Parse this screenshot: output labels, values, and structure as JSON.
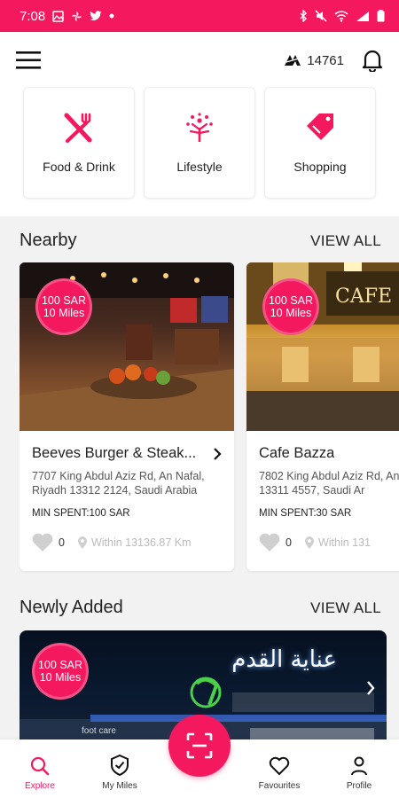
{
  "colors": {
    "accent": "#f4195f",
    "background": "#f2f2f2"
  },
  "status_bar": {
    "time": "7:08",
    "icons_left": [
      "gallery-icon",
      "pinwheel-icon",
      "twitter-icon",
      "dot-icon"
    ],
    "icons_right": [
      "bluetooth-icon",
      "mute-icon",
      "wifi-icon",
      "signal-icon",
      "battery-icon"
    ]
  },
  "header": {
    "menu_icon": "menu-icon",
    "miles_icon": "miles-icon",
    "miles_value": "14761",
    "notification_icon": "bell-icon"
  },
  "categories": [
    {
      "label": "Food & Drink",
      "icon": "fork-knife-icon"
    },
    {
      "label": "Lifestyle",
      "icon": "lifestyle-icon"
    },
    {
      "label": "Shopping",
      "icon": "shopping-tag-icon"
    }
  ],
  "nearby": {
    "title": "Nearby",
    "view_all": "VIEW ALL",
    "items": [
      {
        "badge_top": "100 SAR",
        "badge_bottom": "10 Miles",
        "name": "Beeves Burger & Steak...",
        "address": "7707 King Abdul Aziz Rd, An Nafal, Riyadh 13312 2124, Saudi Arabia",
        "min_spent": "MIN SPENT:100 SAR",
        "likes": "0",
        "distance": "Within 13136.87 Km"
      },
      {
        "badge_top": "100 SAR",
        "badge_bottom": "10 Miles",
        "name": "Cafe Bazza",
        "address": "7802 King Abdul Aziz Rd, An Riyadh 13311 4557, Saudi Ar",
        "min_spent": "MIN SPENT:30 SAR",
        "likes": "0",
        "distance": "Within 131"
      }
    ]
  },
  "newly_added": {
    "title": "Newly Added",
    "view_all": "VIEW ALL",
    "banner": {
      "badge_top": "100 SAR",
      "badge_bottom": "10 Miles",
      "sign_arabic": "عناية القدم",
      "sign_english": "foot care"
    }
  },
  "bottom_nav": [
    {
      "label": "Explore",
      "icon": "search-icon",
      "active": true
    },
    {
      "label": "My Miles",
      "icon": "shield-check-icon",
      "active": false
    },
    {
      "label": "Favourites",
      "icon": "heart-icon",
      "active": false
    },
    {
      "label": "Profile",
      "icon": "person-icon",
      "active": false
    }
  ],
  "scan_button": {
    "icon": "scan-icon"
  }
}
